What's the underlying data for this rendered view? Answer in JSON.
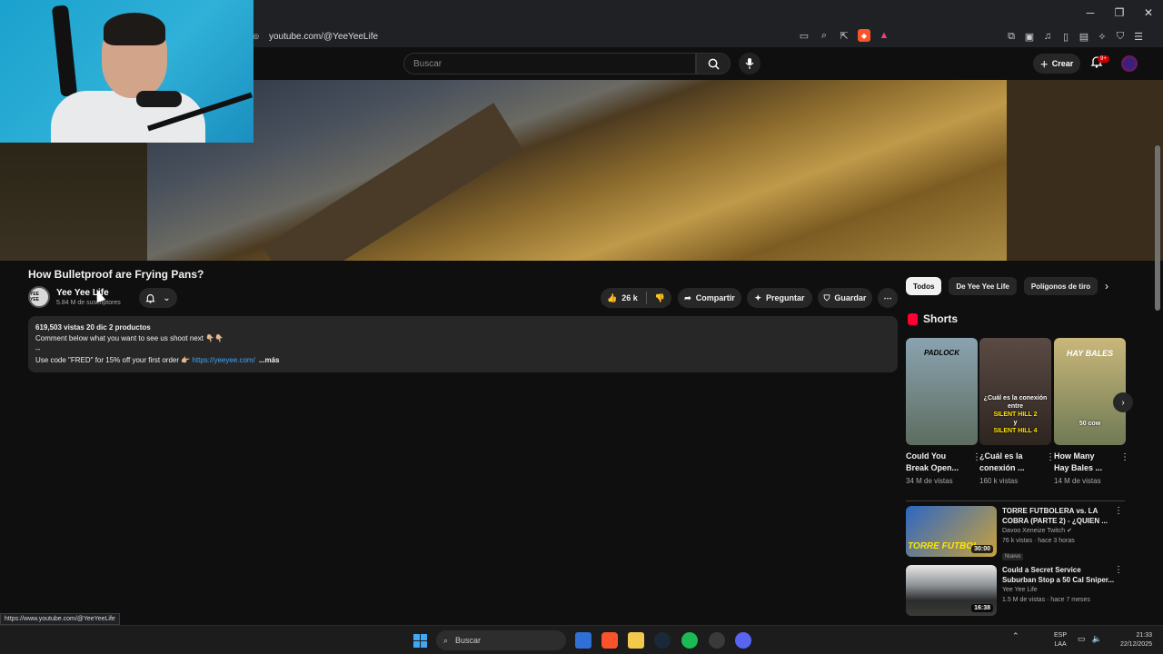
{
  "browser": {
    "url": "youtube.com/@YeeYeeLife",
    "window_controls": [
      "─",
      "❐",
      "✕"
    ],
    "status_url": "https://www.youtube.com/@YeeYeeLife"
  },
  "header": {
    "search_placeholder": "Buscar",
    "create_label": "Crear",
    "notification_badge": "9+"
  },
  "video": {
    "title": "How Bulletproof are Frying Pans?",
    "channel": {
      "name": "Yee Yee Life",
      "subscribers": "5.84 M de suscriptores",
      "avatar_text": "YEE YEE"
    },
    "likes": "26 k",
    "actions": {
      "share": "Compartir",
      "ask": "Preguntar",
      "save": "Guardar"
    }
  },
  "description": {
    "meta": "619,503 vistas  20 dic  2 productos",
    "line1": "Comment below what you want to see us shoot next 👇🏼👇🏼",
    "line2": "--",
    "line3": "Use code \"FRED\" for 15% off your first order 👉🏼 ",
    "link": "https://yeeyee.com/",
    "more": "...más"
  },
  "sidebar": {
    "chips": [
      "Todos",
      "De Yee Yee Life",
      "Polígonos de tiro"
    ],
    "shorts_heading": "Shorts",
    "shorts": [
      {
        "title": "Could You Break Open...",
        "views": "34 M de vistas",
        "label": "PADLOCK",
        "bg": "#6f8a95"
      },
      {
        "title": "¿Cuál es la conexión ...",
        "views": "160 k vistas",
        "overlay1": "¿Cuál es la conexión entre",
        "overlay2": "SILENT HILL 2",
        "overlay3": "y",
        "overlay4": "SILENT HILL 4",
        "bg": "#4a3b35"
      },
      {
        "title": "How Many Hay Bales ...",
        "views": "14 M de vistas",
        "label": "HAY BALES",
        "sub": "50 cow",
        "bg": "#7a8a6a"
      }
    ],
    "recommendations": [
      {
        "title": "TORRE FUTBOLERA vs. LA COBRA (PARTE 2) - ¿QUIEN ...",
        "channel": "Davoo Xeneize Twitch ✔",
        "meta": "76 k vistas · hace 3 horas",
        "badge": "Nuevo",
        "duration": "30:00",
        "thumb_text": "TORRE FUTBOL",
        "bg": "#3b7bd6"
      },
      {
        "title": "Could a Secret Service Suburban Stop a 50 Cal Sniper...",
        "channel": "Yee Yee Life",
        "meta": "1.5 M de vistas · hace 7 meses",
        "duration": "16:38",
        "bg": "#5a5f66"
      }
    ]
  },
  "taskbar": {
    "search": "Buscar",
    "lang_top": "ESP",
    "lang_bottom": "LAA",
    "time": "21:33",
    "date": "22/12/2025"
  }
}
